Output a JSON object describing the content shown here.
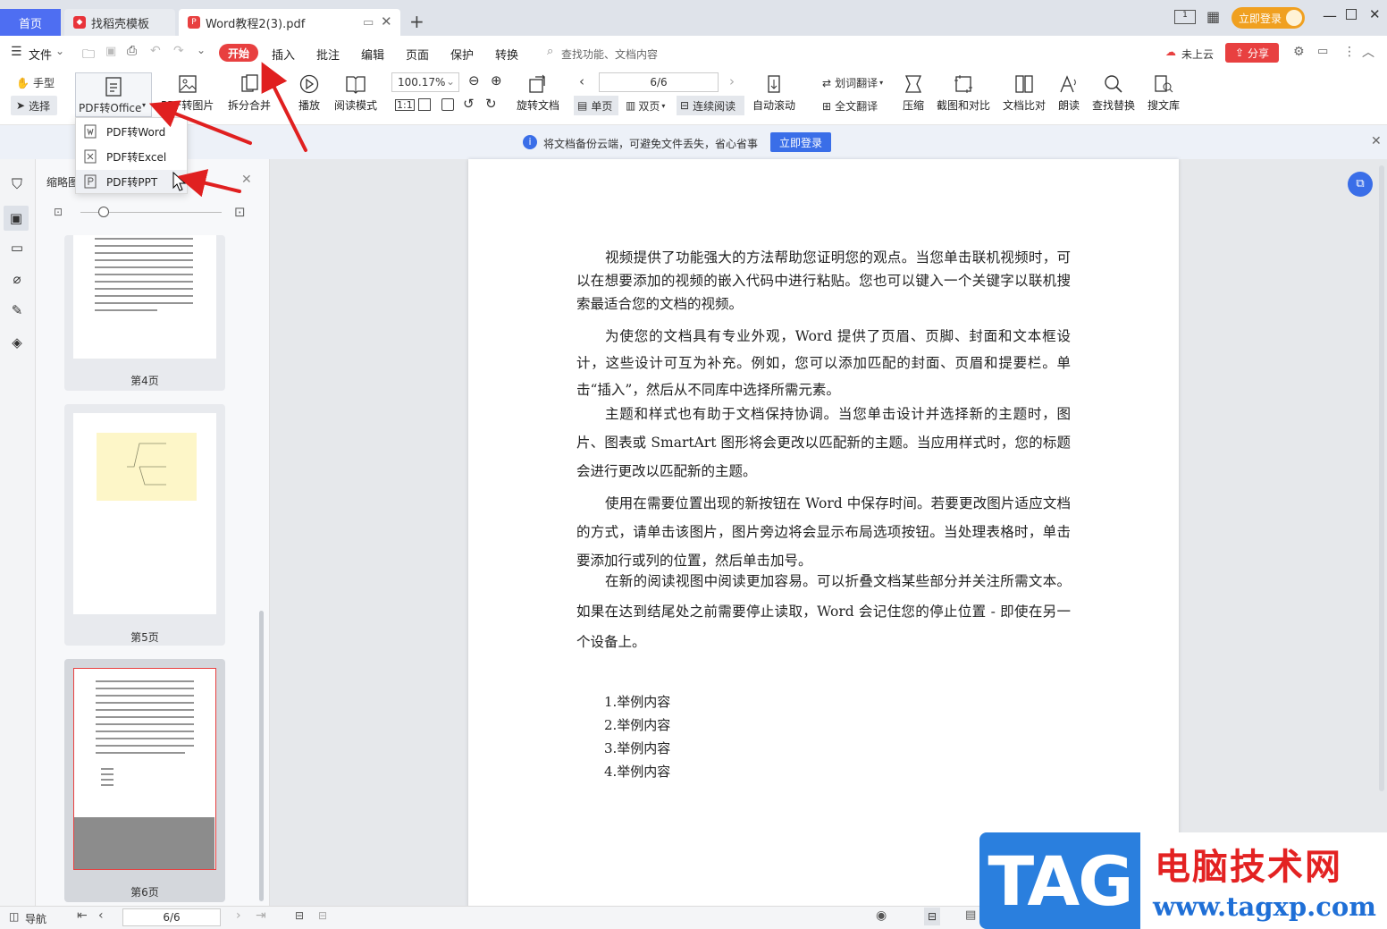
{
  "tabs": {
    "home": "首页",
    "template": "找稻壳模板",
    "doc": "Word教程2(3).pdf"
  },
  "window": {
    "login": "立即登录"
  },
  "toolbar": {
    "file": "文件",
    "menus": [
      "开始",
      "插入",
      "批注",
      "编辑",
      "页面",
      "保护",
      "转换"
    ],
    "search_placeholder": "查找功能、文档内容",
    "cloud": "未上云",
    "share": "分享"
  },
  "ribbon": {
    "hand": "手型",
    "select": "选择",
    "pdf2office": "PDF转Office",
    "pdf2img": "PDF转图片",
    "split": "拆分合并",
    "play": "播放",
    "readmode": "阅读模式",
    "zoom": "100.17%",
    "rotate": "旋转文档",
    "page": "6/6",
    "single": "单页",
    "double": "双页",
    "continuous": "连续阅读",
    "autoscroll": "自动滚动",
    "wordtrans": "划词翻译",
    "fulltrans": "全文翻译",
    "compress": "压缩",
    "screenshot": "截图和对比",
    "compare": "文档比对",
    "read": "朗读",
    "findreplace": "查找替换",
    "library": "搜文库"
  },
  "dropdown": [
    "PDF转Word",
    "PDF转Excel",
    "PDF转PPT"
  ],
  "notice": {
    "text": "将文档备份云端，可避免文件丢失，省心省事",
    "button": "立即登录"
  },
  "thumbs": {
    "title": "缩略图",
    "labels": [
      "第4页",
      "第5页",
      "第6页"
    ]
  },
  "document": {
    "paragraphs": [
      "视频提供了功能强大的方法帮助您证明您的观点。当您单击联机视频时，可以在想要添加的视频的嵌入代码中进行粘贴。您也可以键入一个关键字以联机搜索最适合您的文档的视频。",
      "为使您的文档具有专业外观，Word 提供了页眉、页脚、封面和文本框设计，这些设计可互为补充。例如，您可以添加匹配的封面、页眉和提要栏。单击“插入”，然后从不同库中选择所需元素。",
      "主题和样式也有助于文档保持协调。当您单击设计并选择新的主题时，图片、图表或 SmartArt 图形将会更改以匹配新的主题。当应用样式时，您的标题会进行更改以匹配新的主题。",
      "使用在需要位置出现的新按钮在 Word 中保存时间。若要更改图片适应文档的方式，请单击该图片，图片旁边将会显示布局选项按钮。当处理表格时，单击要添加行或列的位置，然后单击加号。",
      "在新的阅读视图中阅读更加容易。可以折叠文档某些部分并关注所需文本。如果在达到结尾处之前需要停止读取，Word 会记住您的停止位置 - 即使在另一个设备上。"
    ],
    "list": [
      "1.举例内容",
      "2.举例内容",
      "3.举例内容",
      "4.举例内容"
    ]
  },
  "status": {
    "nav": "导航",
    "page": "6/6"
  },
  "watermark": {
    "tag": "TAG",
    "cn": "电脑技术网",
    "url": "www.tagxp.com"
  }
}
